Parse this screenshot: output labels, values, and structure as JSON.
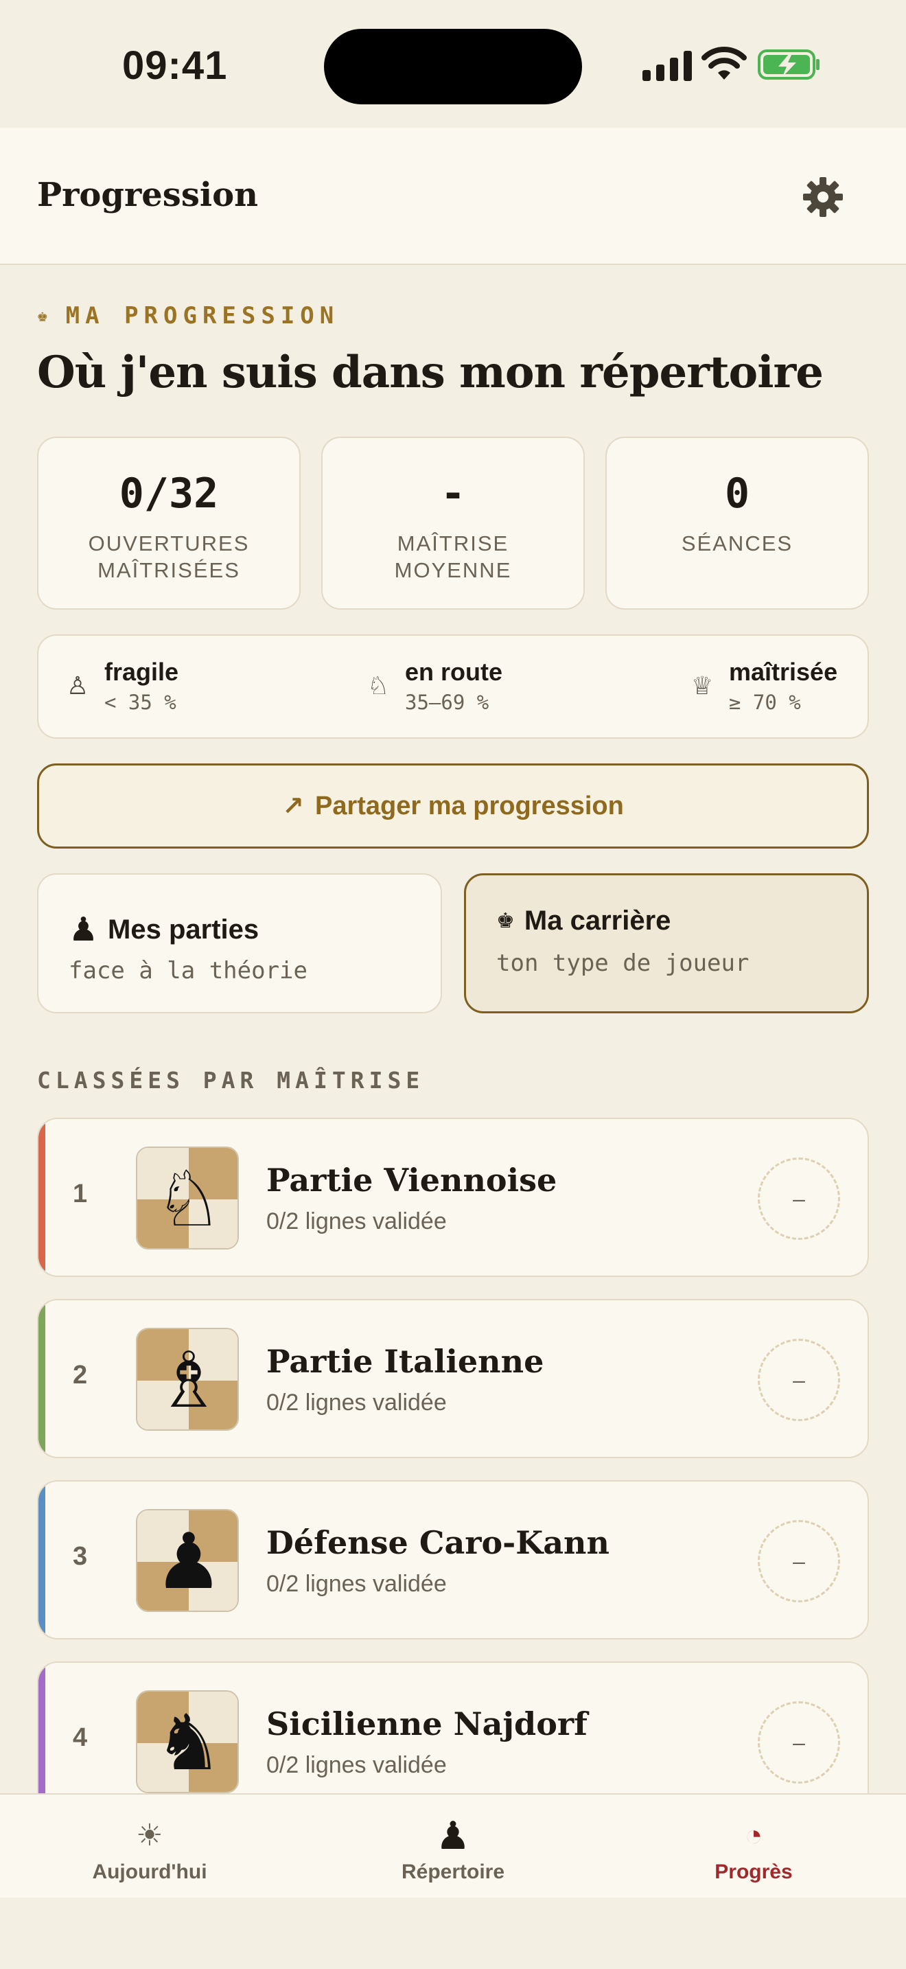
{
  "status": {
    "time": "09:41"
  },
  "header": {
    "title": "Progression"
  },
  "section": {
    "eyebrow": "MA PROGRESSION",
    "title": "Où j'en suis dans mon répertoire"
  },
  "stats": [
    {
      "value": "0/32",
      "label_1": "OUVERTURES",
      "label_2": "MAÎTRISÉES"
    },
    {
      "value": "-",
      "label_1": "MAÎTRISE",
      "label_2": "MOYENNE"
    },
    {
      "value": "0",
      "label_1": "SÉANCES",
      "label_2": ""
    }
  ],
  "legend": [
    {
      "icon": "pawn-icon",
      "glyph": "♙",
      "name": "fragile",
      "range": "< 35 %"
    },
    {
      "icon": "knight-icon",
      "glyph": "♘",
      "name": "en route",
      "range": "35–69 %"
    },
    {
      "icon": "queen-icon",
      "glyph": "♕",
      "name": "maîtrisée",
      "range": "≥ 70 %"
    }
  ],
  "share": {
    "arrow": "↗",
    "label": "Partager ma progression"
  },
  "cards": {
    "games": {
      "glyph": "♟",
      "title": "Mes parties",
      "subtitle": "face à la théorie"
    },
    "career": {
      "glyph": "♚",
      "title": "Ma carrière",
      "subtitle": "ton type de joueur"
    }
  },
  "list_label": "CLASSÉES PAR MAÎTRISE",
  "openings": [
    {
      "rank": "1",
      "name": "Partie Viennoise",
      "lines": "0/2 lignes validée",
      "mastery": "–",
      "piece": "knight-white-icon",
      "glyph": "♘",
      "accent": "#d9664a"
    },
    {
      "rank": "2",
      "name": "Partie Italienne",
      "lines": "0/2 lignes validée",
      "mastery": "–",
      "piece": "bishop-white-icon",
      "glyph": "♗",
      "accent": "#7ea65a"
    },
    {
      "rank": "3",
      "name": "Défense Caro-Kann",
      "lines": "0/2 lignes validée",
      "mastery": "–",
      "piece": "pawn-black-icon",
      "glyph": "♟",
      "accent": "#5b8fc4"
    },
    {
      "rank": "4",
      "name": "Sicilienne Najdorf",
      "lines": "0/2 lignes validée",
      "mastery": "–",
      "piece": "knight-black-icon",
      "glyph": "♞",
      "accent": "#a36cc9"
    }
  ],
  "tabs": [
    {
      "icon": "sun-icon",
      "glyph": "☀",
      "label": "Aujourd'hui",
      "active": false
    },
    {
      "icon": "rook-icon",
      "glyph": "♟",
      "label": "Répertoire",
      "active": false
    },
    {
      "icon": "pie-chart-icon",
      "glyph": "◔",
      "label": "Progrès",
      "active": true
    }
  ],
  "colors": {
    "accent_gold": "#9a7424",
    "active_tab": "#a1282b",
    "board_light": "#efe7d3",
    "board_dark": "#c8a56e"
  }
}
